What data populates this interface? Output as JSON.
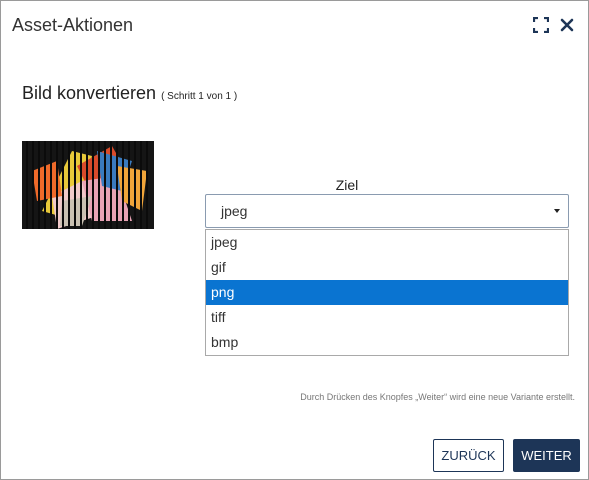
{
  "dialog": {
    "title": "Asset-Aktionen",
    "icons": {
      "fullscreen": "fullscreen-icon",
      "close": "close-icon"
    }
  },
  "step": {
    "title": "Bild konvertieren",
    "subtitle": "( Schritt 1 von 1 )"
  },
  "target": {
    "label": "Ziel",
    "selected_value": "jpeg",
    "options": [
      "jpeg",
      "gif",
      "png",
      "tiff",
      "bmp"
    ],
    "highlighted_option": "png"
  },
  "hint": "Durch Drücken des Knopfes „Weiter“ wird eine neue Variante erstellt.",
  "buttons": {
    "back": "ZURÜCK",
    "next": "WEITER"
  },
  "colors": {
    "primary": "#1d3557",
    "highlight": "#0a74d1"
  }
}
